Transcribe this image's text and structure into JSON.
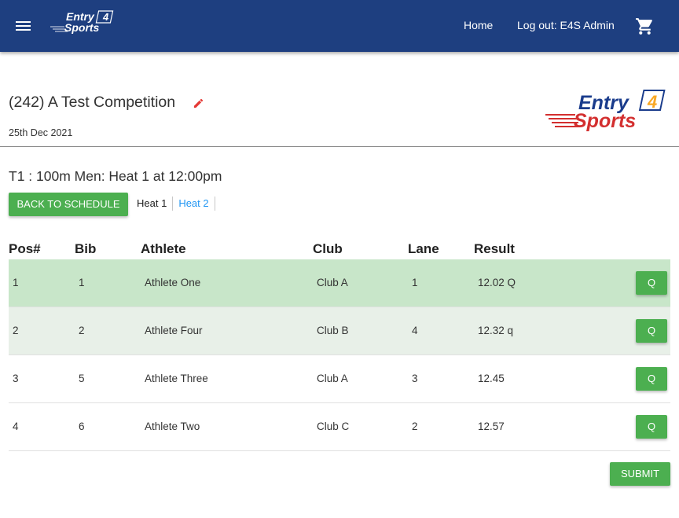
{
  "nav": {
    "logo_line1": "Entry",
    "logo_badge": "4",
    "logo_line2": "Sports",
    "home": "Home",
    "logout": "Log out: E4S Admin",
    "icons": [
      "menu-icon",
      "cart-icon"
    ]
  },
  "competition": {
    "title": "(242) A Test Competition",
    "date": "25th Dec 2021",
    "logo_line1": "Entry",
    "logo_badge": "4",
    "logo_line2": "Sports"
  },
  "event": {
    "title": "T1 : 100m Men: Heat 1 at 12:00pm",
    "back_label": "BACK TO SCHEDULE",
    "heats": [
      "Heat 1",
      "Heat 2"
    ],
    "active_heat": "Heat 1"
  },
  "table": {
    "headers": [
      "Pos#",
      "Bib",
      "Athlete",
      "Club",
      "Lane",
      "Result"
    ],
    "rows": [
      {
        "pos": "1",
        "bib": "1",
        "athlete": "Athlete One",
        "club": "Club A",
        "lane": "1",
        "result": "12.02 Q",
        "action": "Q"
      },
      {
        "pos": "2",
        "bib": "2",
        "athlete": "Athlete Four",
        "club": "Club B",
        "lane": "4",
        "result": "12.32 q",
        "action": "Q"
      },
      {
        "pos": "3",
        "bib": "5",
        "athlete": "Athlete Three",
        "club": "Club A",
        "lane": "3",
        "result": "12.45",
        "action": "Q"
      },
      {
        "pos": "4",
        "bib": "6",
        "athlete": "Athlete Two",
        "club": "Club C",
        "lane": "2",
        "result": "12.57",
        "action": "Q"
      }
    ]
  },
  "submit_label": "SUBMIT",
  "colors": {
    "nav_bg": "#1e3f80",
    "button": "#4caf50",
    "row_qualified": "#c8e6c9",
    "row_light": "#e8f0e8",
    "link": "#2196f3",
    "edit_icon": "#e53935",
    "logo_blue": "#1a3c8c",
    "logo_red": "#d32f2f"
  }
}
